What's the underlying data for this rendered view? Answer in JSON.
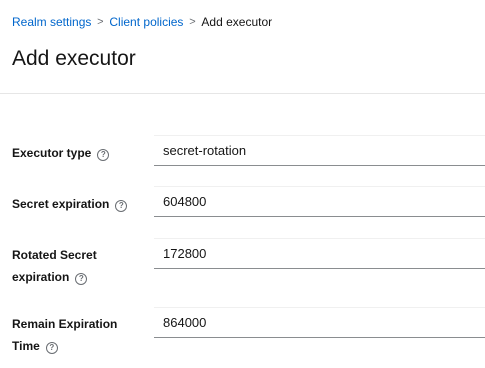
{
  "breadcrumb": {
    "items": [
      "Realm settings",
      "Client policies"
    ],
    "separator": ">",
    "current": "Add executor"
  },
  "page_title": "Add executor",
  "help_icon_glyph": "?",
  "form": {
    "executor_type": {
      "label": "Executor type",
      "value": "secret-rotation"
    },
    "secret_expiration": {
      "label": "Secret expiration",
      "value": "604800"
    },
    "rotated_secret_expiration": {
      "label_line1": "Rotated Secret",
      "label_line2": "expiration",
      "value": "172800"
    },
    "remain_expiration_time": {
      "label_line1": "Remain Expiration",
      "label_line2": "Time",
      "value": "864000"
    }
  },
  "colors": {
    "link": "#0066cc",
    "text": "#151515",
    "input_border": "#8a8d90"
  },
  "icons": [
    "chevron-right-icon",
    "help-icon"
  ]
}
